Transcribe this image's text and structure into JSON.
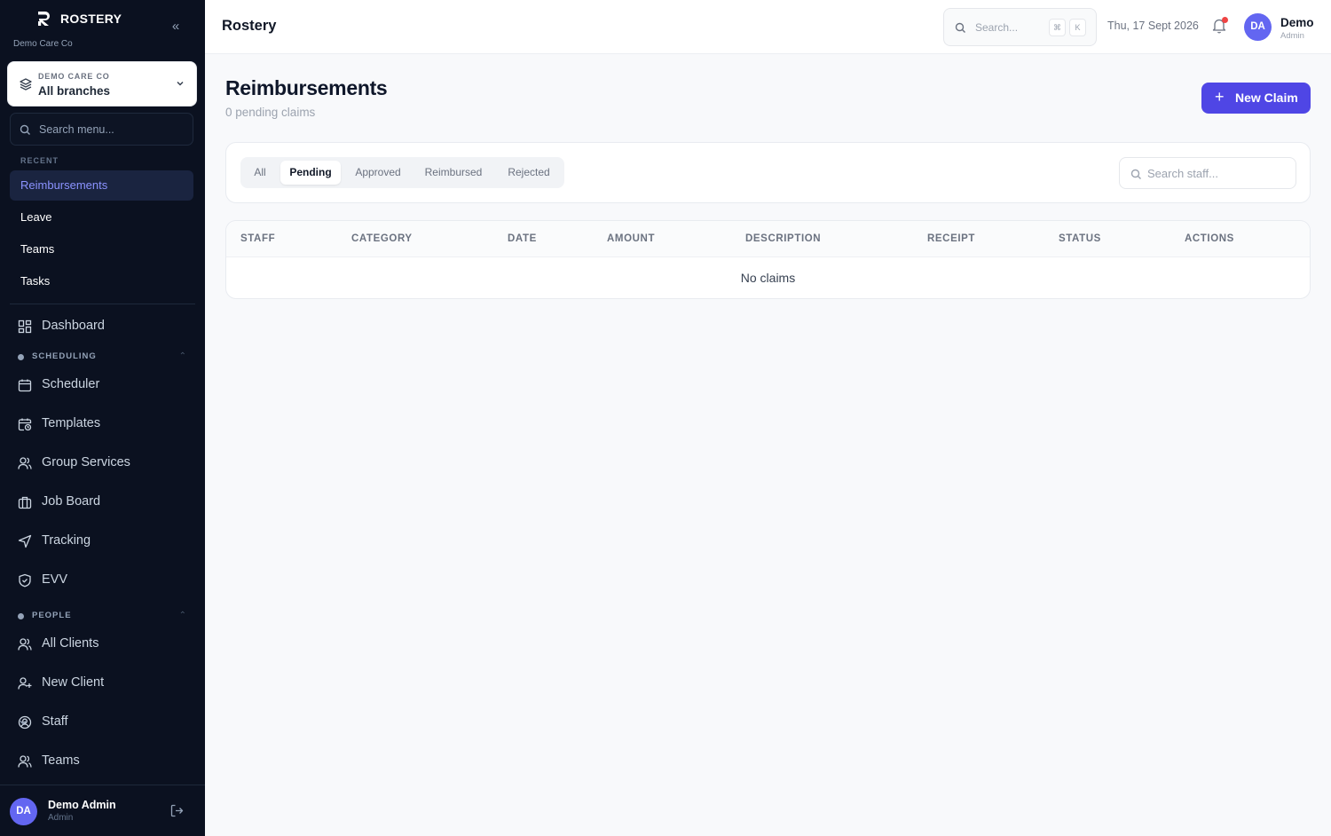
{
  "app": {
    "brand": "ROSTERY",
    "org_subtitle": "Demo Care Co",
    "topbar_title": "Rostery"
  },
  "branch_selector": {
    "kicker": "DEMO CARE CO",
    "value": "All branches"
  },
  "menu_search": {
    "placeholder": "Search menu..."
  },
  "recent": {
    "label": "RECENT",
    "items": [
      {
        "label": "Reimbursements",
        "active": true
      },
      {
        "label": "Leave"
      },
      {
        "label": "Teams"
      },
      {
        "label": "Tasks"
      }
    ]
  },
  "nav": {
    "dashboard": "Dashboard",
    "scheduling_group": "SCHEDULING",
    "scheduling": [
      "Scheduler",
      "Templates",
      "Group Services",
      "Job Board",
      "Tracking",
      "EVV"
    ],
    "people_group": "PEOPLE",
    "people": [
      "All Clients",
      "New Client",
      "Staff",
      "Teams"
    ]
  },
  "footer_user": {
    "initials": "DA",
    "name": "Demo Admin",
    "role": "Admin"
  },
  "topbar": {
    "search_placeholder": "Search...",
    "shortcut_keys": [
      "⌘",
      "K"
    ],
    "date": "Thu, 17 Sept 2026",
    "user_initials": "DA",
    "user_name": "Demo",
    "user_role": "Admin"
  },
  "page": {
    "title": "Reimbursements",
    "subtitle": "0 pending claims",
    "new_claim_label": "New Claim"
  },
  "filters": {
    "tabs": [
      "All",
      "Pending",
      "Approved",
      "Reimbursed",
      "Rejected"
    ],
    "active_tab": "Pending",
    "staff_search_placeholder": "Search staff..."
  },
  "table": {
    "columns": [
      "STAFF",
      "CATEGORY",
      "DATE",
      "AMOUNT",
      "DESCRIPTION",
      "RECEIPT",
      "STATUS",
      "ACTIONS"
    ],
    "rows": [],
    "empty_text": "No claims"
  },
  "colors": {
    "sidebar_bg": "#0b1120",
    "accent": "#4f46e5",
    "avatar": "#6366f1",
    "notification_dot": "#ef4444"
  }
}
